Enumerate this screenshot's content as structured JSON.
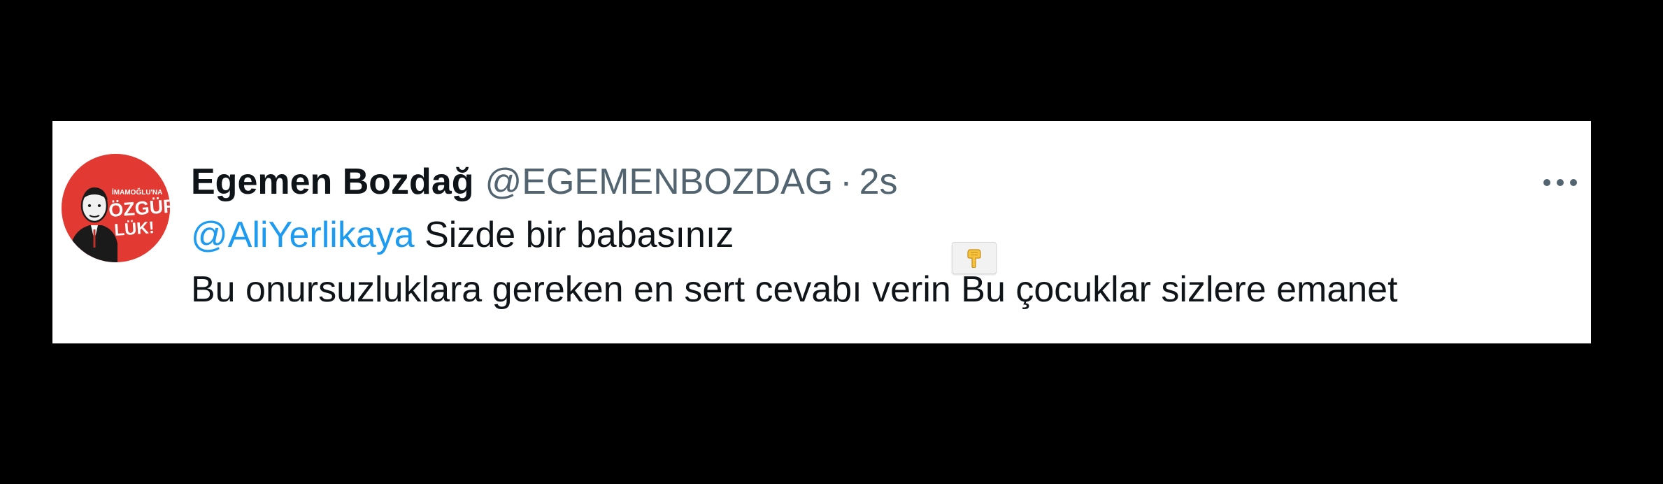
{
  "tweet": {
    "author": {
      "display_name": "Egemen Bozdağ",
      "handle": "@EGEMENBOZDAG",
      "avatar_text": [
        "İMAMOĞLU'NA",
        "ÖZGÜR-",
        "LÜK!"
      ]
    },
    "separator": "·",
    "timestamp": "2s",
    "mention": "@AliYerlikaya",
    "line1_text": " Sizde bir babasınız",
    "line2_text": "Bu onursuzluklara gereken en sert cevabı verin Bu çocuklar sizlere emanet",
    "emoji_name": "backhand-index-pointing-down",
    "more_icon": "ellipsis-icon"
  },
  "colors": {
    "background": "#000000",
    "card": "#ffffff",
    "text": "#0f1419",
    "secondary": "#536471",
    "link": "#1d9bf0",
    "avatar": "#e23a32"
  }
}
